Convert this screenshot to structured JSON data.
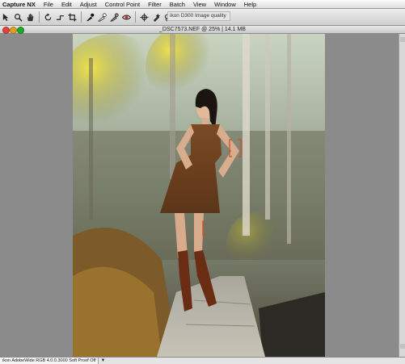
{
  "app": {
    "name": "Capture NX"
  },
  "menu": [
    "File",
    "Edit",
    "Adjust",
    "Control Point",
    "Filter",
    "Batch",
    "View",
    "Window",
    "Help"
  ],
  "toolbar": {
    "icons": [
      "pointer-icon",
      "zoom-icon",
      "hand-icon",
      "rotate-icon",
      "straighten-icon",
      "crop-icon",
      "black-point-icon",
      "white-point-icon",
      "neutral-point-icon",
      "red-eye-icon",
      "color-control-point-icon",
      "auto-retouch-icon",
      "lasso-icon",
      "marquee-icon",
      "brush-icon",
      "fill-icon",
      "gradient-icon"
    ],
    "camera_label": "ikon D300 Image quality"
  },
  "document": {
    "title": "_DSC7573.NEF @ 25% | 14.1 MB",
    "traffic_lights": {
      "close": "#e0443e",
      "minimize": "#dea123",
      "zoom": "#1aab29"
    }
  },
  "status": {
    "text": "ikon AdobeWide RGB 4.0.0.3000  Soft Proof Off",
    "arrow": "▼"
  }
}
